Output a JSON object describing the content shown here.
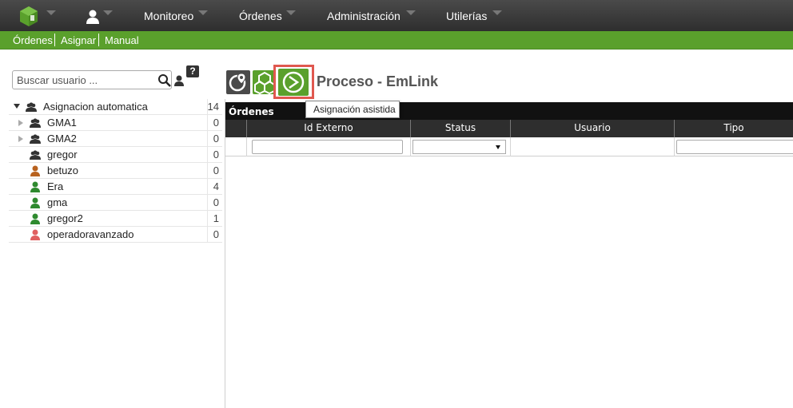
{
  "topbar": {
    "logo_icon": "green-cube-logo-icon",
    "user_icon": "user-icon",
    "menu": [
      {
        "label": "Monitoreo"
      },
      {
        "label": "Órdenes"
      },
      {
        "label": "Administración"
      },
      {
        "label": "Utilerías"
      }
    ]
  },
  "subnav": {
    "links": [
      {
        "label": "Órdenes"
      },
      {
        "label": "Asignar"
      },
      {
        "label": "Manual"
      }
    ]
  },
  "sidebar": {
    "search": {
      "placeholder": "Buscar usuario ...",
      "value": ""
    },
    "help_label": "?",
    "tree": [
      {
        "label": "Asignacion automatica",
        "count": "14",
        "icon": "group-icon",
        "expander": "open",
        "color": "#333333"
      },
      {
        "label": "GMA1",
        "count": "0",
        "icon": "group-icon",
        "expander": "closed",
        "color": "#333333"
      },
      {
        "label": "GMA2",
        "count": "0",
        "icon": "group-icon",
        "expander": "closed",
        "color": "#333333"
      },
      {
        "label": "gregor",
        "count": "0",
        "icon": "group-icon",
        "expander": "none",
        "color": "#333333"
      },
      {
        "label": "betuzo",
        "count": "0",
        "icon": "user-icon",
        "expander": "none",
        "color": "#b8621f"
      },
      {
        "label": "Era",
        "count": "4",
        "icon": "user-icon",
        "expander": "none",
        "color": "#2f8a2f"
      },
      {
        "label": "gma",
        "count": "0",
        "icon": "user-icon",
        "expander": "none",
        "color": "#2f8a2f"
      },
      {
        "label": "gregor2",
        "count": "1",
        "icon": "user-icon",
        "expander": "none",
        "color": "#2f8a2f"
      },
      {
        "label": "operadoravanzado",
        "count": "0",
        "icon": "user-icon",
        "expander": "none",
        "color": "#e06060"
      }
    ]
  },
  "toolbar": {
    "buttons": [
      {
        "icon": "map-pin-globe-icon"
      },
      {
        "icon": "cubes-icon"
      },
      {
        "icon": "assisted-assignment-icon"
      }
    ],
    "title": "Proceso - EmLink",
    "tooltip": "Asignación asistida"
  },
  "grid": {
    "caption": "Órdenes",
    "columns": [
      "",
      "Id Externo",
      "Status",
      "Usuario",
      "Tipo"
    ],
    "filter_status_value": ""
  },
  "colors": {
    "accent_green": "#5aa02c",
    "topbar": "#3a3a3a",
    "highlight_red": "#e0584f"
  }
}
